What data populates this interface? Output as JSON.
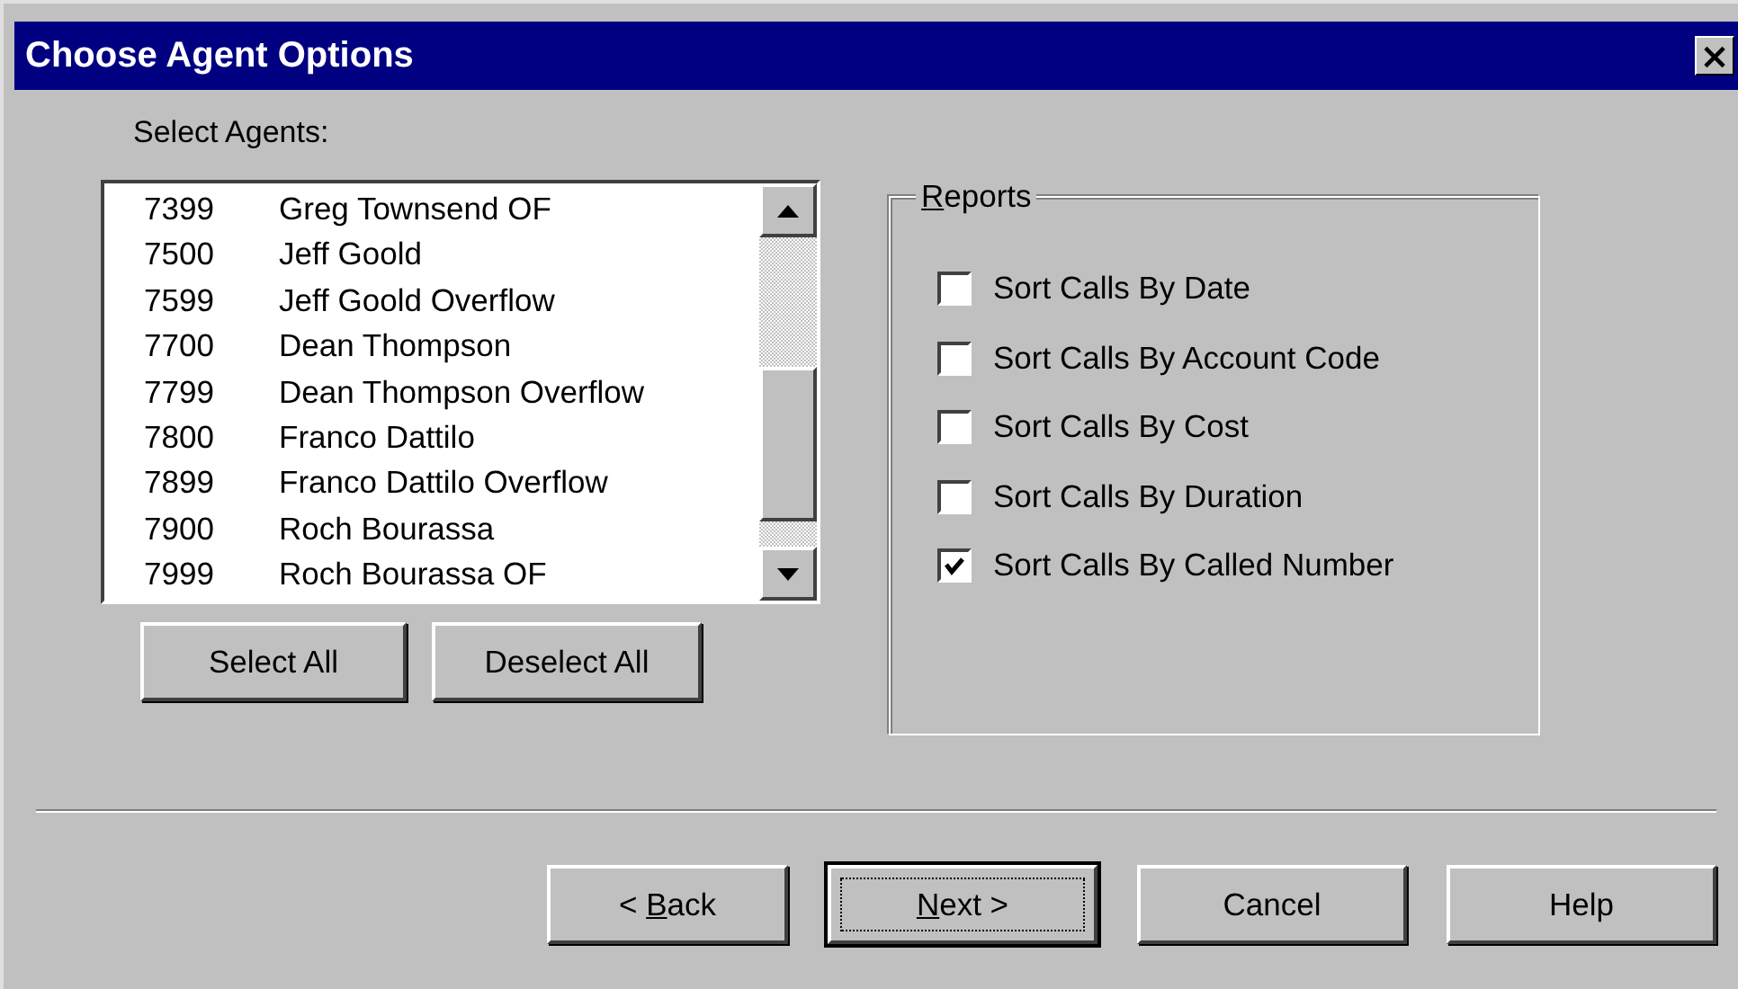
{
  "window": {
    "title": "Choose Agent Options",
    "close": "×"
  },
  "agents": {
    "label": "Select Agents:",
    "items": [
      {
        "number": "7399",
        "name": "Greg Townsend OF"
      },
      {
        "number": "7500",
        "name": "Jeff Goold"
      },
      {
        "number": "7599",
        "name": "Jeff Goold Overflow"
      },
      {
        "number": "7700",
        "name": "Dean Thompson"
      },
      {
        "number": "7799",
        "name": "Dean Thompson Overflow"
      },
      {
        "number": "7800",
        "name": "Franco Dattilo"
      },
      {
        "number": "7899",
        "name": "Franco Dattilo Overflow"
      },
      {
        "number": "7900",
        "name": "Roch Bourassa"
      },
      {
        "number": "7999",
        "name": "Roch Bourassa OF"
      }
    ],
    "buttons": [
      "Select All",
      "Deselect All"
    ]
  },
  "reports": {
    "legend": {
      "key": "R",
      "after": "eports"
    },
    "options": [
      {
        "label": "Sort Calls By Date",
        "checked": false
      },
      {
        "label": "Sort Calls By Account Code",
        "checked": false
      },
      {
        "label": "Sort Calls By Cost",
        "checked": false
      },
      {
        "label": "Sort Calls By Duration",
        "checked": false
      },
      {
        "label": "Sort Calls By Called Number",
        "checked": true
      }
    ]
  },
  "buttons": [
    {
      "before": "< ",
      "key": "B",
      "after": "ack",
      "default": false
    },
    {
      "key": "N",
      "after": "ext >",
      "default": true
    },
    {
      "before": "Cancel",
      "default": false
    },
    {
      "before": "Help",
      "default": false
    }
  ]
}
